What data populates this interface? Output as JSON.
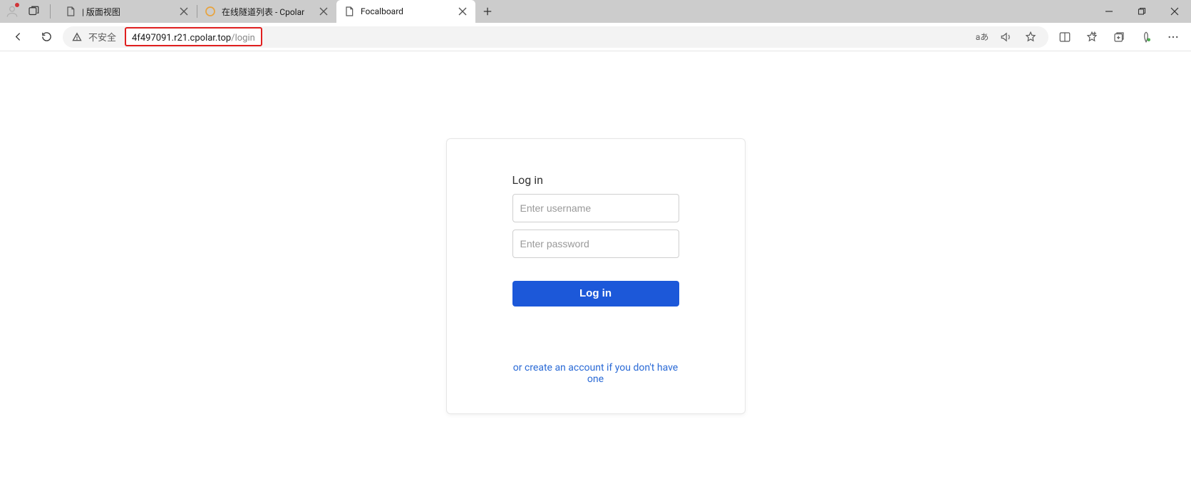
{
  "browser": {
    "tabs": [
      {
        "title": "| 版面视图",
        "active": false,
        "favicon": "page"
      },
      {
        "title": "在线隧道列表 - Cpolar",
        "active": false,
        "favicon": "cpolar"
      },
      {
        "title": "Focalboard",
        "active": true,
        "favicon": "page"
      }
    ],
    "not_secure_label": "不安全",
    "url_host": "4f497091.r21.cpolar.top",
    "url_path": "/login",
    "translate_glyph": "aあ"
  },
  "login": {
    "title": "Log in",
    "username_placeholder": "Enter username",
    "password_placeholder": "Enter password",
    "button_label": "Log in",
    "signup_link": "or create an account if you don't have one"
  }
}
